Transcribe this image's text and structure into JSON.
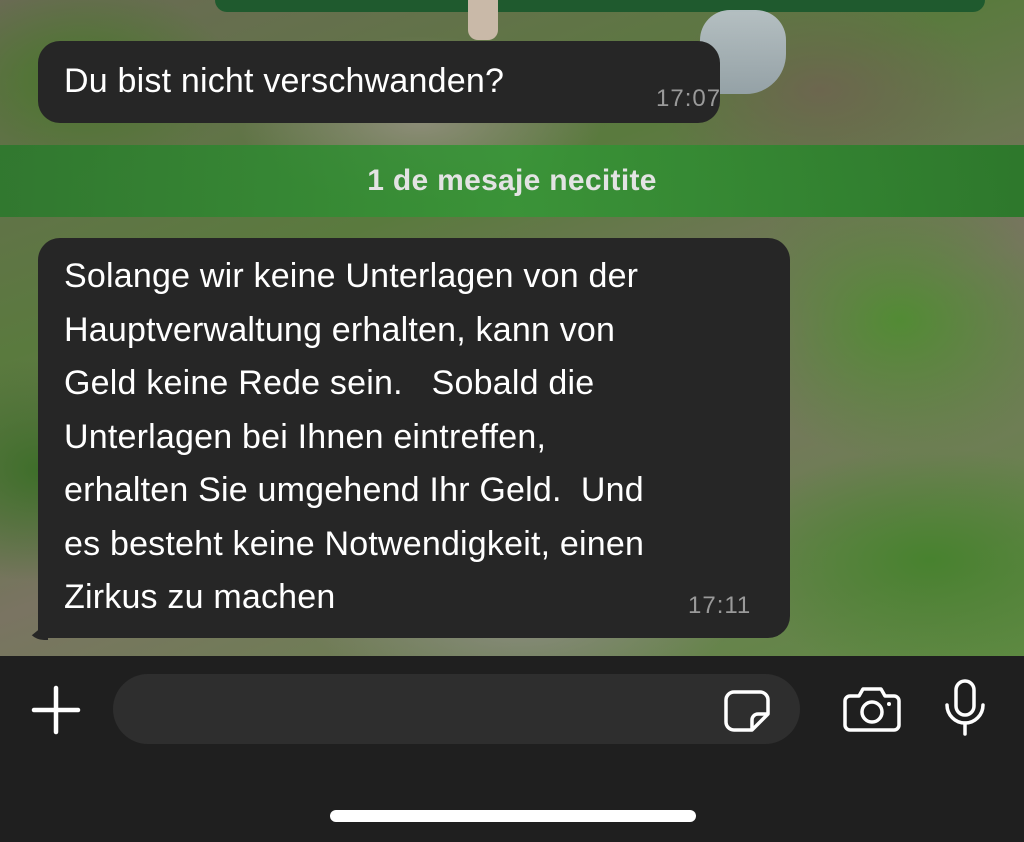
{
  "messages": [
    {
      "text": "Du bist nicht verschwanden?",
      "time": "17:07"
    },
    {
      "text": "Solange wir keine Unterlagen von der\nHauptverwaltung erhalten, kann von\nGeld keine Rede sein.   Sobald die\nUnterlagen bei Ihnen eintreffen,\nerhalten Sie umgehend Ihr Geld.  Und\nes besteht keine Notwendigkeit, einen\nZirkus zu machen",
      "time": "17:11"
    }
  ],
  "unread_banner": "1 de mesaje necitite",
  "composer": {
    "input_value": "",
    "icons": [
      "plus-icon",
      "sticker-icon",
      "camera-icon",
      "microphone-icon"
    ]
  },
  "colors": {
    "bubble": "#262626",
    "banner": "#2f8a3a",
    "composer_bg": "#1f1f1f"
  }
}
